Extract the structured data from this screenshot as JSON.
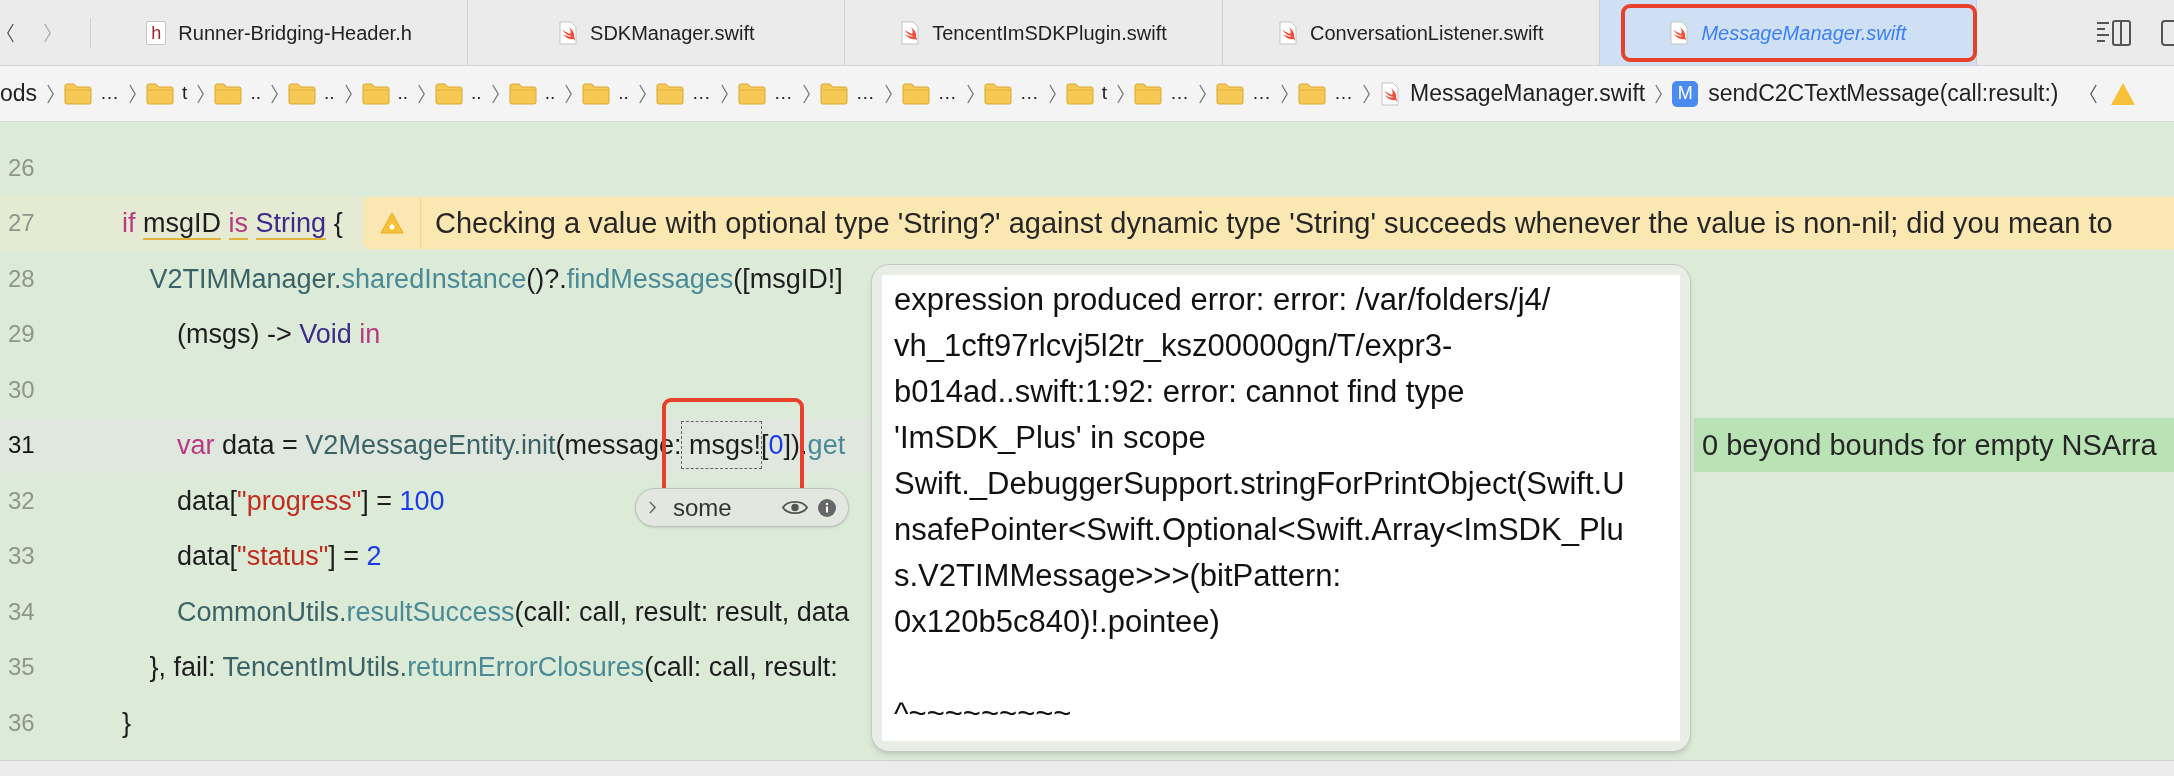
{
  "tabs": [
    {
      "label": "Runner-Bridging-Header.h",
      "kind": "header",
      "badge": "h",
      "selected": false
    },
    {
      "label": "SDKManager.swift",
      "kind": "swift",
      "selected": false
    },
    {
      "label": "TencentImSDKPlugin.swift",
      "kind": "swift",
      "selected": false
    },
    {
      "label": "ConversationListener.swift",
      "kind": "swift",
      "selected": false
    },
    {
      "label": "MessageManager.swift",
      "kind": "swift",
      "selected": true
    }
  ],
  "breadcrumb": [
    {
      "kind": "text",
      "label": "ods"
    },
    {
      "kind": "folder",
      "label": "…"
    },
    {
      "kind": "folder",
      "label": "t"
    },
    {
      "kind": "folder",
      "label": ".."
    },
    {
      "kind": "folder",
      "label": ".."
    },
    {
      "kind": "folder",
      "label": ".."
    },
    {
      "kind": "folder",
      "label": ".."
    },
    {
      "kind": "folder",
      "label": ".."
    },
    {
      "kind": "folder",
      "label": ".."
    },
    {
      "kind": "folder",
      "label": "…"
    },
    {
      "kind": "folder",
      "label": "…"
    },
    {
      "kind": "folder",
      "label": "…"
    },
    {
      "kind": "folder",
      "label": "…"
    },
    {
      "kind": "folder",
      "label": "…"
    },
    {
      "kind": "folder",
      "label": "t"
    },
    {
      "kind": "folder",
      "label": "…"
    },
    {
      "kind": "folder",
      "label": "…"
    },
    {
      "kind": "folder",
      "label": "…"
    },
    {
      "kind": "file",
      "label": "MessageManager.swift"
    },
    {
      "kind": "method",
      "badge": "M",
      "label": "sendC2CTextMessage(call:result:)"
    }
  ],
  "editor": {
    "lines": [
      {
        "number": "26",
        "current": false
      },
      {
        "number": "27",
        "current": false,
        "tokens": [
          {
            "text": "if ",
            "kind": "keyword",
            "underlined": false,
            "boxed": false
          },
          {
            "text": "msgID",
            "kind": "plain",
            "underlined": true,
            "boxed": false
          },
          {
            "text": " is",
            "kind": "keyword",
            "underlined": true,
            "boxed": false
          },
          {
            "text": " String",
            "kind": "type",
            "underlined": true,
            "boxed": false
          },
          {
            "text": " {",
            "kind": "plain",
            "underlined": false,
            "boxed": false
          }
        ],
        "annotation": {
          "kind": "warning",
          "text": "Checking a value with optional type 'String?' against dynamic type 'String' succeeds whenever the value is non-nil; did you mean to"
        },
        "children": [
          {
            "number": "28",
            "current": false,
            "tokens": [
              {
                "text": "V2TIMManager.",
                "kind": "class",
                "underlined": false,
                "boxed": false
              },
              {
                "text": "sharedInstance",
                "kind": "method",
                "underlined": false,
                "boxed": false
              },
              {
                "text": "()?.",
                "kind": "plain",
                "underlined": false,
                "boxed": false
              },
              {
                "text": "findMessages",
                "kind": "method",
                "underlined": false,
                "boxed": false
              },
              {
                "text": "([msgID!]",
                "kind": "plain",
                "underlined": false,
                "boxed": false
              }
            ],
            "children": [
              {
                "number": "29",
                "current": false,
                "tokens": [
                  {
                    "text": "(msgs) -> ",
                    "kind": "plain",
                    "underlined": false,
                    "boxed": false
                  },
                  {
                    "text": "Void",
                    "kind": "type",
                    "underlined": false,
                    "boxed": false
                  },
                  {
                    "text": " in",
                    "kind": "keyword",
                    "underlined": false,
                    "boxed": false
                  }
                ]
              },
              {
                "number": "30",
                "current": false
              },
              {
                "number": "31",
                "current": true,
                "tokens": [
                  {
                    "text": "var",
                    "kind": "keyword",
                    "underlined": false,
                    "boxed": false
                  },
                  {
                    "text": " data = ",
                    "kind": "plain",
                    "underlined": false,
                    "boxed": false
                  },
                  {
                    "text": "V2MessageEntity.init",
                    "kind": "class",
                    "underlined": false,
                    "boxed": false
                  },
                  {
                    "text": "(message: ",
                    "kind": "plain",
                    "underlined": false,
                    "boxed": false
                  },
                  {
                    "text": "msgs",
                    "kind": "plain",
                    "underlined": false,
                    "boxed": true
                  },
                  {
                    "text": "![",
                    "kind": "plain",
                    "underlined": false,
                    "boxed": false
                  },
                  {
                    "text": "0",
                    "kind": "number",
                    "underlined": false,
                    "boxed": false
                  },
                  {
                    "text": "]).",
                    "kind": "plain",
                    "underlined": false,
                    "boxed": false
                  },
                  {
                    "text": "get",
                    "kind": "method",
                    "underlined": false,
                    "boxed": false
                  }
                ],
                "annotation": {
                  "kind": "thread-stop",
                  "text": "0 beyond bounds for empty NSArra"
                }
              },
              {
                "number": "32",
                "current": false,
                "tokens": [
                  {
                    "text": "data[",
                    "kind": "plain",
                    "underlined": false,
                    "boxed": false
                  },
                  {
                    "text": "\"progress\"",
                    "kind": "string",
                    "underlined": false,
                    "boxed": false
                  },
                  {
                    "text": "] = ",
                    "kind": "plain",
                    "underlined": false,
                    "boxed": false
                  },
                  {
                    "text": "100",
                    "kind": "number",
                    "underlined": false,
                    "boxed": false
                  }
                ]
              },
              {
                "number": "33",
                "current": false,
                "tokens": [
                  {
                    "text": "data[",
                    "kind": "plain",
                    "underlined": false,
                    "boxed": false
                  },
                  {
                    "text": "\"status\"",
                    "kind": "string",
                    "underlined": false,
                    "boxed": false
                  },
                  {
                    "text": "] = ",
                    "kind": "plain",
                    "underlined": false,
                    "boxed": false
                  },
                  {
                    "text": "2",
                    "kind": "number",
                    "underlined": false,
                    "boxed": false
                  }
                ]
              },
              {
                "number": "34",
                "current": false,
                "tokens": [
                  {
                    "text": "CommonUtils.",
                    "kind": "class",
                    "underlined": false,
                    "boxed": false
                  },
                  {
                    "text": "resultSuccess",
                    "kind": "method",
                    "underlined": false,
                    "boxed": false
                  },
                  {
                    "text": "(call: call, result: result, data",
                    "kind": "plain",
                    "underlined": false,
                    "boxed": false
                  }
                ]
              }
            ]
          },
          {
            "number": "35",
            "current": false,
            "tokens": [
              {
                "text": "}, fail: ",
                "kind": "plain",
                "underlined": false,
                "boxed": false
              },
              {
                "text": "TencentImUtils.",
                "kind": "class",
                "underlined": false,
                "boxed": false
              },
              {
                "text": "returnErrorClosures",
                "kind": "method",
                "underlined": false,
                "boxed": false
              },
              {
                "text": "(call: call, result:",
                "kind": "plain",
                "underlined": false,
                "boxed": false
              }
            ]
          }
        ]
      },
      {
        "number": "36",
        "current": false,
        "tokens": [
          {
            "text": "}",
            "kind": "plain",
            "underlined": false,
            "boxed": false
          }
        ]
      }
    ]
  },
  "value_pill": {
    "label": "some"
  },
  "debug_popover": {
    "lines": [
      "expression produced error: error: /var/folders/j4/",
      "vh_1cft97rlcvj5l2tr_ksz00000gn/T/expr3-",
      "b014ad..swift:1:92: error: cannot find type",
      "'ImSDK_Plus' in scope",
      "Swift._DebuggerSupport.stringForPrintObject(Swift.U",
      "nsafePointer<Swift.Optional<Swift.Array<ImSDK_Plu",
      "s.V2TIMMessage>>>(bitPattern:",
      "0x120b5c840)!.pointee)"
    ],
    "caret_line": "^~~~~~~~~~"
  }
}
